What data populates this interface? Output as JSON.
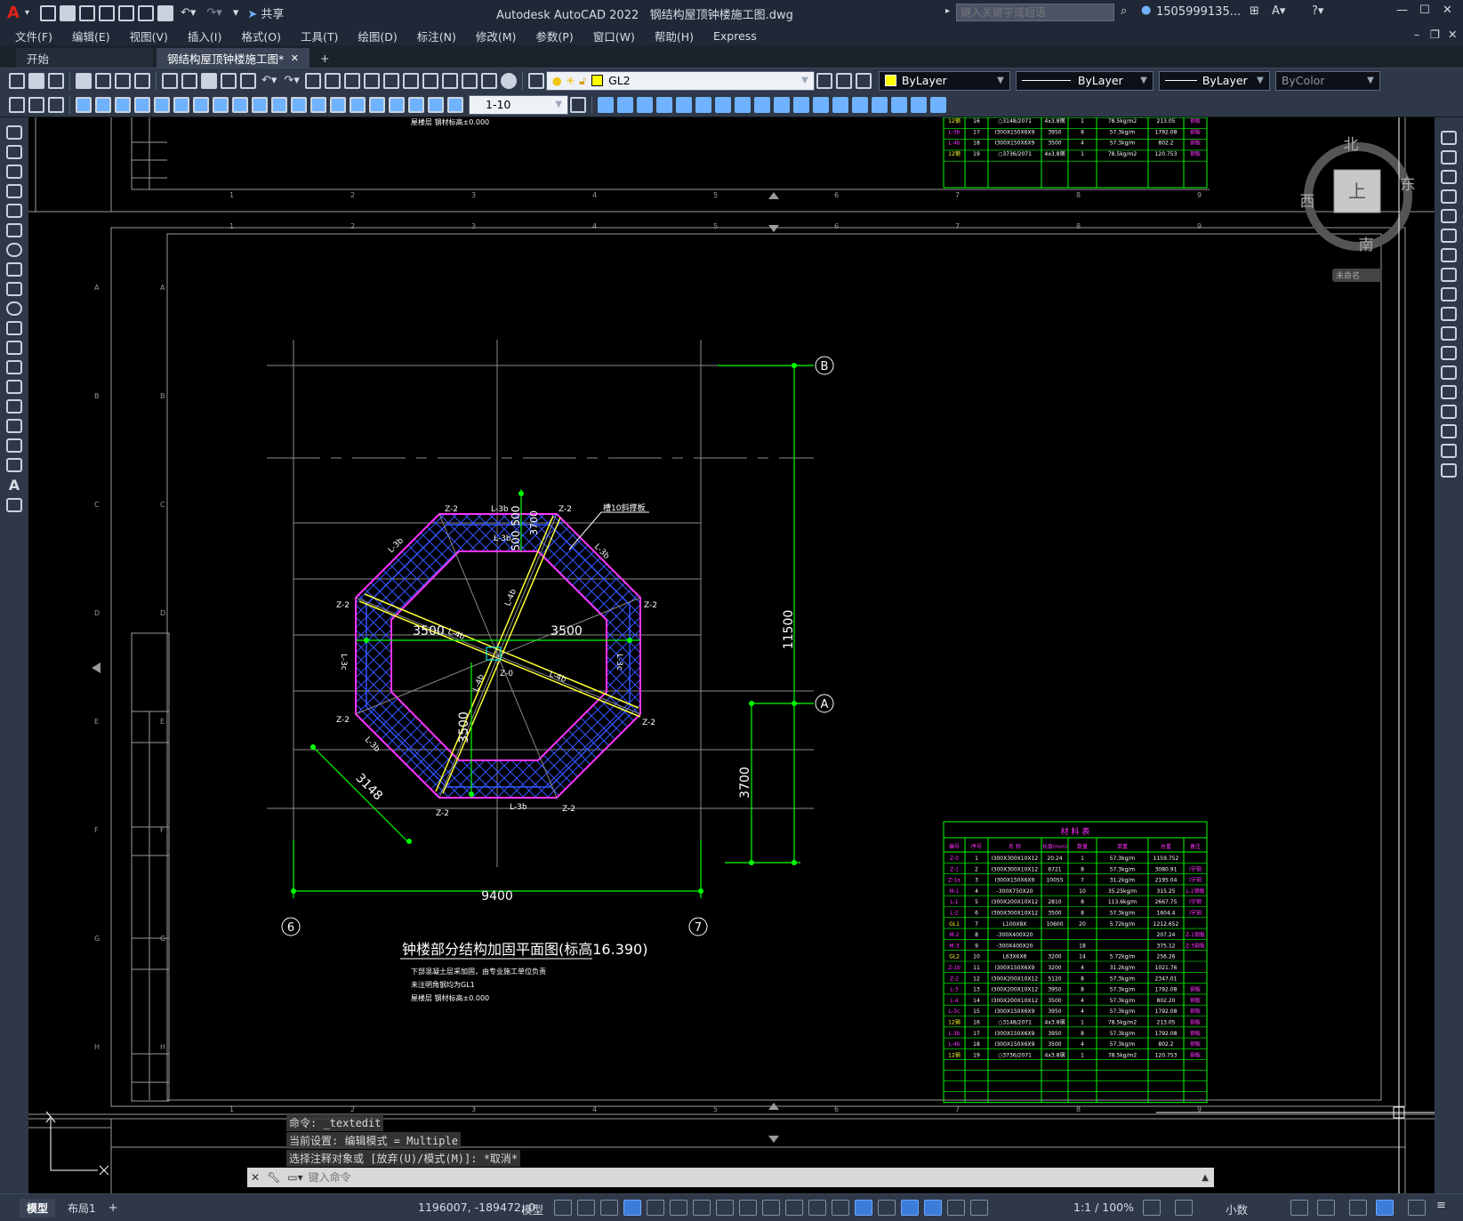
{
  "window": {
    "app_title": "Autodesk AutoCAD 2022",
    "file_name": "钢结构屋顶钟楼施工图.dwg",
    "search_placeholder": "键入关键字或短语",
    "user": "1505999135...",
    "share": "共享"
  },
  "menu": [
    "文件(F)",
    "编辑(E)",
    "视图(V)",
    "插入(I)",
    "格式(O)",
    "工具(T)",
    "绘图(D)",
    "标注(N)",
    "修改(M)",
    "参数(P)",
    "窗口(W)",
    "帮助(H)",
    "Express"
  ],
  "tabs": {
    "start": "开始",
    "active": "钢结构屋顶钟楼施工图*",
    "close": "✕",
    "add": "+"
  },
  "properties": {
    "layer": "GL2",
    "color": "ByLayer",
    "linetype": "ByLayer",
    "lineweight": "ByLayer",
    "plotstyle": "ByColor",
    "scale": "1-10"
  },
  "viewcube": {
    "north": "北",
    "south": "南",
    "east": "东",
    "west": "西",
    "top": "上",
    "ucs": "未命名"
  },
  "drawing": {
    "title": "钟楼部分结构加固平面图(标高16.390)",
    "notes": [
      "下部混凝土层采加固，由专业施工单位负责",
      "未注明角钢均为GL1",
      "屋楼层 钢材标高±0.000"
    ],
    "top_note": "屋楼层 钢材标高±0.000",
    "dims": {
      "total_width": "9400",
      "half_left": "3500",
      "half_right": "3500",
      "vertical_total": "11500",
      "vertical_lower": "3700",
      "side_500a": "500",
      "side_500b": "500",
      "side_3700": "3700",
      "diag_3500": "3500",
      "diag_3148": "3148"
    },
    "axes": {
      "B": "B",
      "A": "A",
      "six": "6",
      "seven": "7"
    },
    "member_labels": [
      "Z-2",
      "Z-2",
      "Z-2",
      "Z-2",
      "Z-2",
      "Z-2",
      "Z-2",
      "Z-2",
      "Z-0",
      "L-3b",
      "L-3b",
      "L-3b",
      "L-3b",
      "L-4b",
      "L-4b",
      "L-4b",
      "L-4b",
      "L-3c",
      "L-3c",
      "L-3b",
      "L-3b"
    ],
    "callout": "槽10斜撑板",
    "grid_top": [
      "1",
      "2",
      "3",
      "4",
      "5",
      "6",
      "7",
      "8",
      "9"
    ],
    "grid_side": [
      "A",
      "B",
      "C",
      "D",
      "E",
      "F",
      "G",
      "H"
    ]
  },
  "material_table": {
    "title": "材 料 表",
    "headers": [
      "编号",
      "序号",
      "名 称",
      "长度(mm)",
      "数量",
      "单重",
      "总重",
      "备注"
    ],
    "rows": [
      [
        "Z-0",
        "1",
        "I300X300X10X12",
        "20.24",
        "1",
        "57.3kg/m",
        "1159.752",
        ""
      ],
      [
        "Z-1",
        "2",
        "I300X300X10X12",
        "6721",
        "8",
        "57.3kg/m",
        "3080.91",
        "I字钢"
      ],
      [
        "Z-1a",
        "3",
        "I300X150X6X9",
        "10055",
        "7",
        "31.2kg/m",
        "2195.04",
        "I字钢"
      ],
      [
        "M-1",
        "4",
        "-300X750X20",
        "",
        "10",
        "35.25kg/m",
        "315.25",
        "L-1钢板"
      ],
      [
        "L-1",
        "5",
        "I300X200X10X12",
        "2810",
        "8",
        "113.6kg/m",
        "2667.75",
        "I字钢"
      ],
      [
        "L-2",
        "6",
        "I300X300X10X12",
        "3500",
        "8",
        "57.3kg/m",
        "1604.4",
        "I字钢"
      ],
      [
        "GL1",
        "7",
        "L100X8X",
        "10600",
        "20",
        "5.72kg/m",
        "1212.652",
        ""
      ],
      [
        "M-2",
        "8",
        "-300X400X20",
        "",
        "",
        "",
        "207.24",
        "Z-1钢板"
      ],
      [
        "M-3",
        "9",
        "-300X400X20",
        "",
        "18",
        "",
        "375.12",
        "Z-3钢板"
      ],
      [
        "GL2",
        "10",
        "L63X6X6",
        "3200",
        "14",
        "5.72kg/m",
        "256.26",
        ""
      ],
      [
        "Z-1b",
        "11",
        "I300X150X6X9",
        "3200",
        "4",
        "31.2kg/m",
        "1021.76",
        ""
      ],
      [
        "Z-2",
        "12",
        "I300X200X10X12",
        "5120",
        "8",
        "57.3kg/m",
        "2347.01",
        ""
      ],
      [
        "L-3",
        "13",
        "I300X200X10X12",
        "3950",
        "8",
        "57.3kg/m",
        "1792.08",
        "钢板"
      ],
      [
        "L-4",
        "14",
        "I300X200X10X12",
        "3500",
        "4",
        "57.3kg/m",
        "802.20",
        "钢板"
      ],
      [
        "L-3c",
        "15",
        "I300X150X6X9",
        "3950",
        "4",
        "57.3kg/m",
        "1792.08",
        "钢板"
      ],
      [
        "12钢",
        "16",
        "○3148/2071",
        "4x3.8钢",
        "1",
        "78.5kg/m2",
        "213.05",
        "钢板"
      ],
      [
        "L-3b",
        "17",
        "I300X150X6X9",
        "3950",
        "8",
        "57.3kg/m",
        "1792.08",
        "钢板"
      ],
      [
        "L-4b",
        "18",
        "I300X150X6X9",
        "3500",
        "4",
        "57.3kg/m",
        "802.2",
        "钢板"
      ],
      [
        "12钢",
        "19",
        "○3736/2071",
        "4x3.8钢",
        "1",
        "78.5kg/m2",
        "120.753",
        "钢板"
      ]
    ]
  },
  "command": {
    "line1": "命令: _textedit",
    "line2": "当前设置: 编辑模式 = Multiple",
    "line3": "选择注释对象或 [放弃(U)/模式(M)]: *取消*",
    "placeholder": "键入命令"
  },
  "status": {
    "model_tab": "模型",
    "layout_tab": "布局1",
    "coords": "1196007, -189472, 0",
    "space": "模型",
    "scale": "1:1 / 100%",
    "units": "小数"
  },
  "colors": {
    "green": "#00ff00",
    "magenta": "#ff00ff",
    "blue": "#3355ff",
    "yellow": "#ffff33",
    "gray": "#8a8a8a",
    "accent": "#3b7dd8"
  }
}
